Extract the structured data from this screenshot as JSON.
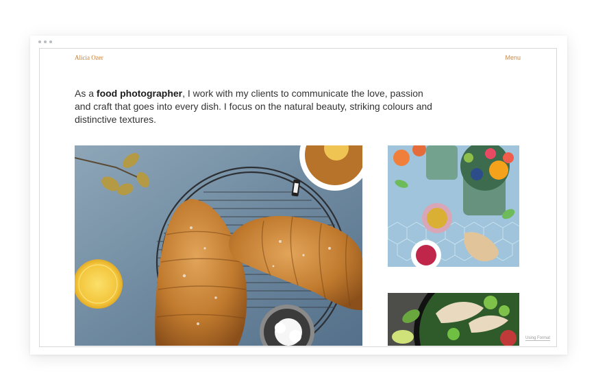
{
  "site": {
    "brand": "Alicia Ozer",
    "menu_label": "Menu"
  },
  "intro": {
    "prefix": "As a ",
    "highlight": "food photographer",
    "suffix": ", I work with my clients to communicate the love, passion and craft that goes into every dish. I focus on the natural beauty, striking colours and distinctive textures."
  },
  "gallery": [
    {
      "subject": "croissants-on-cooling-rack"
    },
    {
      "subject": "smoothie-bowls-with-ginger-and-passion-fruit"
    },
    {
      "subject": "salad-bowl-with-greens"
    }
  ],
  "footer": {
    "credit": "Using Format"
  },
  "colors": {
    "accent": "#c57a31",
    "text": "#333333"
  }
}
